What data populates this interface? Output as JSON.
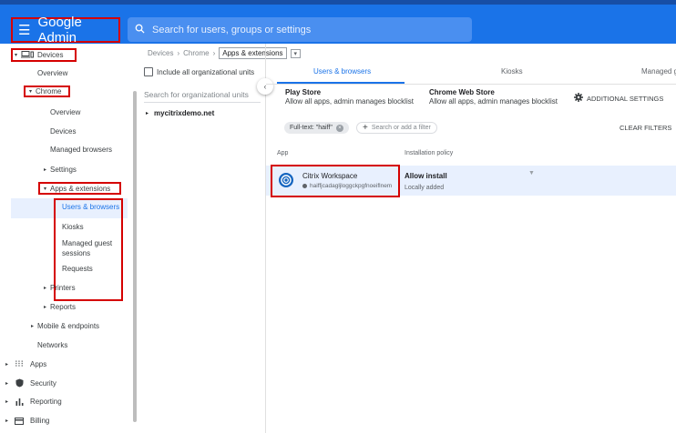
{
  "topbar": {
    "app_title": "Google Admin",
    "search_placeholder": "Search for users, groups or settings"
  },
  "breadcrumb": {
    "items": [
      "Devices",
      "Chrome",
      "Apps & extensions"
    ],
    "separator": "›"
  },
  "sidebar": {
    "devices": "Devices",
    "overview": "Overview",
    "chrome": "Chrome",
    "chrome_overview": "Overview",
    "chrome_devices": "Devices",
    "managed_browsers": "Managed browsers",
    "settings": "Settings",
    "apps_extensions": "Apps & extensions",
    "users_browsers": "Users & browsers",
    "kiosks": "Kiosks",
    "managed_guest_sessions": "Managed guest sessions",
    "requests": "Requests",
    "printers": "Printers",
    "reports": "Reports",
    "mobile_endpoints": "Mobile & endpoints",
    "networks": "Networks",
    "apps": "Apps",
    "security": "Security",
    "reporting": "Reporting",
    "billing": "Billing"
  },
  "orgpanel": {
    "include_all_label": "Include all organizational units",
    "search_placeholder": "Search for organizational units",
    "org_unit": "mycitrixdemo.net"
  },
  "tabs": [
    "Users & browsers",
    "Kiosks",
    "Managed g"
  ],
  "stores": {
    "play_title": "Play Store",
    "play_desc": "Allow all apps, admin manages blocklist",
    "web_title": "Chrome Web Store",
    "web_desc": "Allow all apps, admin manages blocklist",
    "additional_settings": "ADDITIONAL SETTINGS"
  },
  "filters": {
    "chip_label": "Full-text: \"haiff\"",
    "add_placeholder": "Search or add a filter",
    "clear": "CLEAR FILTERS"
  },
  "table": {
    "headers": [
      "App",
      "Installation policy"
    ],
    "rows": [
      {
        "app_name": "Citrix Workspace",
        "app_id": "haiffjcadagljloggckpgfnoeiflnem",
        "policy": "Allow install",
        "policy_sub": "Locally added"
      }
    ]
  },
  "colors": {
    "brand": "#1a73e8",
    "highlight_box": "#d50000",
    "selected_row": "#e8f0fe"
  }
}
